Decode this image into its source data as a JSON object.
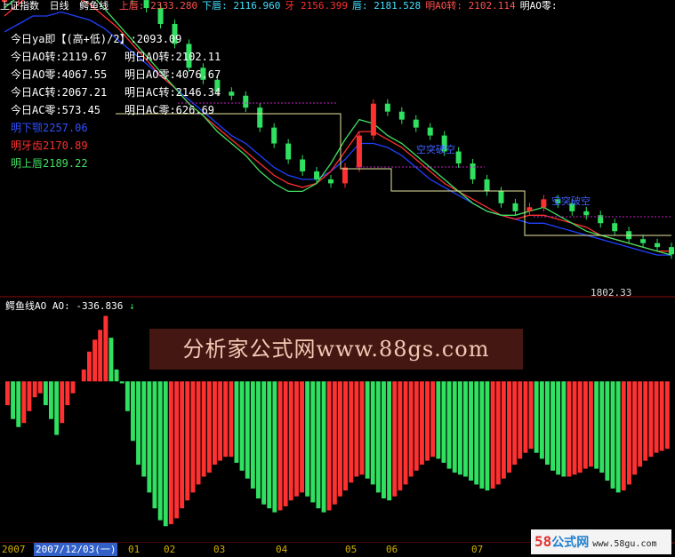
{
  "header": {
    "index_name": "上证指数",
    "period": "日线",
    "indicator": "鳄鱼线",
    "items": [
      {
        "label": "上唇:",
        "value": "2333.280",
        "color": "#ff5050"
      },
      {
        "label": "下唇:",
        "value": "2116.960",
        "color": "#40e0ff"
      },
      {
        "label": "牙",
        "value": "2156.399",
        "color": "#ff3030"
      },
      {
        "label": "唇:",
        "value": "2181.528",
        "color": "#40e0ff"
      },
      {
        "label": "明AO转:",
        "value": "2102.114",
        "color": "#ff5050"
      },
      {
        "label": "明AO零:",
        "value": "",
        "color": "#ffffff"
      }
    ]
  },
  "legend": [
    {
      "text": "今日ya即【(高+低)/2】:2093.09",
      "color": "#ffffff"
    },
    {
      "text": "今日AO转:2119.67",
      "color": "#ffffff"
    },
    {
      "text": "明日AO转:2102.11",
      "color": "#ffffff"
    },
    {
      "text": "今日AO零:4067.55",
      "color": "#ffffff"
    },
    {
      "text": "明日AO零:4076.67",
      "color": "#ffffff"
    },
    {
      "text": "今日AC转:2067.21",
      "color": "#ffffff"
    },
    {
      "text": "明日AC转:2146.34",
      "color": "#ffffff"
    },
    {
      "text": "今日AC零:573.45",
      "color": "#ffffff"
    },
    {
      "text": "明日AC零:626.69",
      "color": "#ffffff"
    },
    {
      "text": "明下颚2257.06",
      "color": "#3050ff"
    },
    {
      "text": "明牙齿2170.89",
      "color": "#ff3030"
    },
    {
      "text": "明上唇2189.22",
      "color": "#40e060"
    }
  ],
  "annotations": {
    "breakout_label": "空突破空",
    "low_label": "1802.33"
  },
  "ao_panel": {
    "title": "鳄鱼线AO",
    "value_label": "AO:",
    "value": "-336.836",
    "arrow": "↓"
  },
  "watermark": "分析家公式网www.88gs.com",
  "date_axis": {
    "labels": [
      "2007",
      "2007/12/03(一)",
      "01",
      "02",
      "03",
      "04",
      "05",
      "06",
      "07"
    ]
  },
  "site_badge": {
    "brand": "58",
    "name": "公式网",
    "url": "www.58gu.com"
  },
  "colors": {
    "up": "#ff3030",
    "down": "#30e060",
    "jaw": "#2040ff",
    "teeth": "#ff3030",
    "lips": "#40e060",
    "yellow_line": "#e8e8a0",
    "dotted": "#c020c0"
  },
  "chart_data": {
    "type": "candlestick+histogram",
    "price_range": [
      1700,
      2400
    ],
    "low_marker": 1802.33,
    "price_series": [
      2440,
      2470,
      2520,
      2480,
      2540,
      2500,
      2560,
      2510,
      2470,
      2440,
      2420,
      2380,
      2330,
      2270,
      2240,
      2210,
      2200,
      2170,
      2120,
      2080,
      2040,
      2010,
      1990,
      1980,
      2020,
      2100,
      2180,
      2160,
      2140,
      2120,
      2100,
      2060,
      2030,
      1990,
      1960,
      1930,
      1910,
      1920,
      1940,
      1930,
      1910,
      1900,
      1880,
      1860,
      1840,
      1830,
      1820,
      1802
    ],
    "jaw_series": [
      2360,
      2380,
      2400,
      2400,
      2410,
      2400,
      2390,
      2370,
      2340,
      2310,
      2280,
      2250,
      2220,
      2190,
      2160,
      2130,
      2100,
      2080,
      2050,
      2020,
      2000,
      1990,
      1990,
      2010,
      2040,
      2080,
      2080,
      2070,
      2050,
      2020,
      1990,
      1970,
      1950,
      1930,
      1910,
      1900,
      1890,
      1880,
      1880,
      1870,
      1860,
      1850,
      1840,
      1830,
      1820,
      1810,
      1800,
      1800
    ],
    "teeth_series": [
      2400,
      2430,
      2460,
      2450,
      2470,
      2450,
      2430,
      2400,
      2370,
      2330,
      2290,
      2250,
      2220,
      2180,
      2150,
      2120,
      2090,
      2060,
      2030,
      2000,
      1980,
      1970,
      1980,
      2010,
      2060,
      2110,
      2110,
      2090,
      2070,
      2040,
      2010,
      1980,
      1960,
      1940,
      1920,
      1900,
      1890,
      1900,
      1900,
      1890,
      1880,
      1870,
      1850,
      1840,
      1830,
      1820,
      1810,
      1810
    ],
    "lips_series": [
      2420,
      2450,
      2490,
      2470,
      2500,
      2480,
      2460,
      2420,
      2380,
      2340,
      2300,
      2260,
      2220,
      2180,
      2150,
      2110,
      2080,
      2050,
      2010,
      1980,
      1960,
      1960,
      1980,
      2030,
      2090,
      2140,
      2130,
      2100,
      2080,
      2050,
      2020,
      1990,
      1960,
      1930,
      1910,
      1900,
      1900,
      1910,
      1920,
      1900,
      1880,
      1860,
      1850,
      1840,
      1830,
      1820,
      1810,
      1800
    ],
    "ao_values": [
      -120,
      -190,
      -230,
      -210,
      -150,
      -80,
      -60,
      -120,
      -190,
      -270,
      -210,
      -120,
      -60,
      0,
      60,
      150,
      210,
      260,
      330,
      220,
      60,
      -10,
      -150,
      -300,
      -420,
      -480,
      -560,
      -640,
      -700,
      -730,
      -720,
      -690,
      -640,
      -600,
      -560,
      -520,
      -480,
      -460,
      -420,
      -400,
      -380,
      -380,
      -410,
      -450,
      -490,
      -540,
      -590,
      -620,
      -640,
      -660,
      -650,
      -630,
      -600,
      -580,
      -560,
      -580,
      -610,
      -640,
      -660,
      -650,
      -620,
      -580,
      -550,
      -510,
      -480,
      -470,
      -490,
      -520,
      -560,
      -590,
      -600,
      -580,
      -550,
      -520,
      -480,
      -450,
      -420,
      -400,
      -380,
      -390,
      -410,
      -440,
      -460,
      -470,
      -480,
      -500,
      -520,
      -540,
      -550,
      -540,
      -520,
      -490,
      -460,
      -420,
      -390,
      -360,
      -340,
      -360,
      -390,
      -420,
      -450,
      -470,
      -480,
      -480,
      -470,
      -460,
      -440,
      -430,
      -440,
      -460,
      -500,
      -540,
      -560,
      -550,
      -520,
      -470,
      -430,
      -400,
      -380,
      -360,
      -350,
      -340
    ],
    "ao_range": [
      -800,
      400
    ]
  }
}
